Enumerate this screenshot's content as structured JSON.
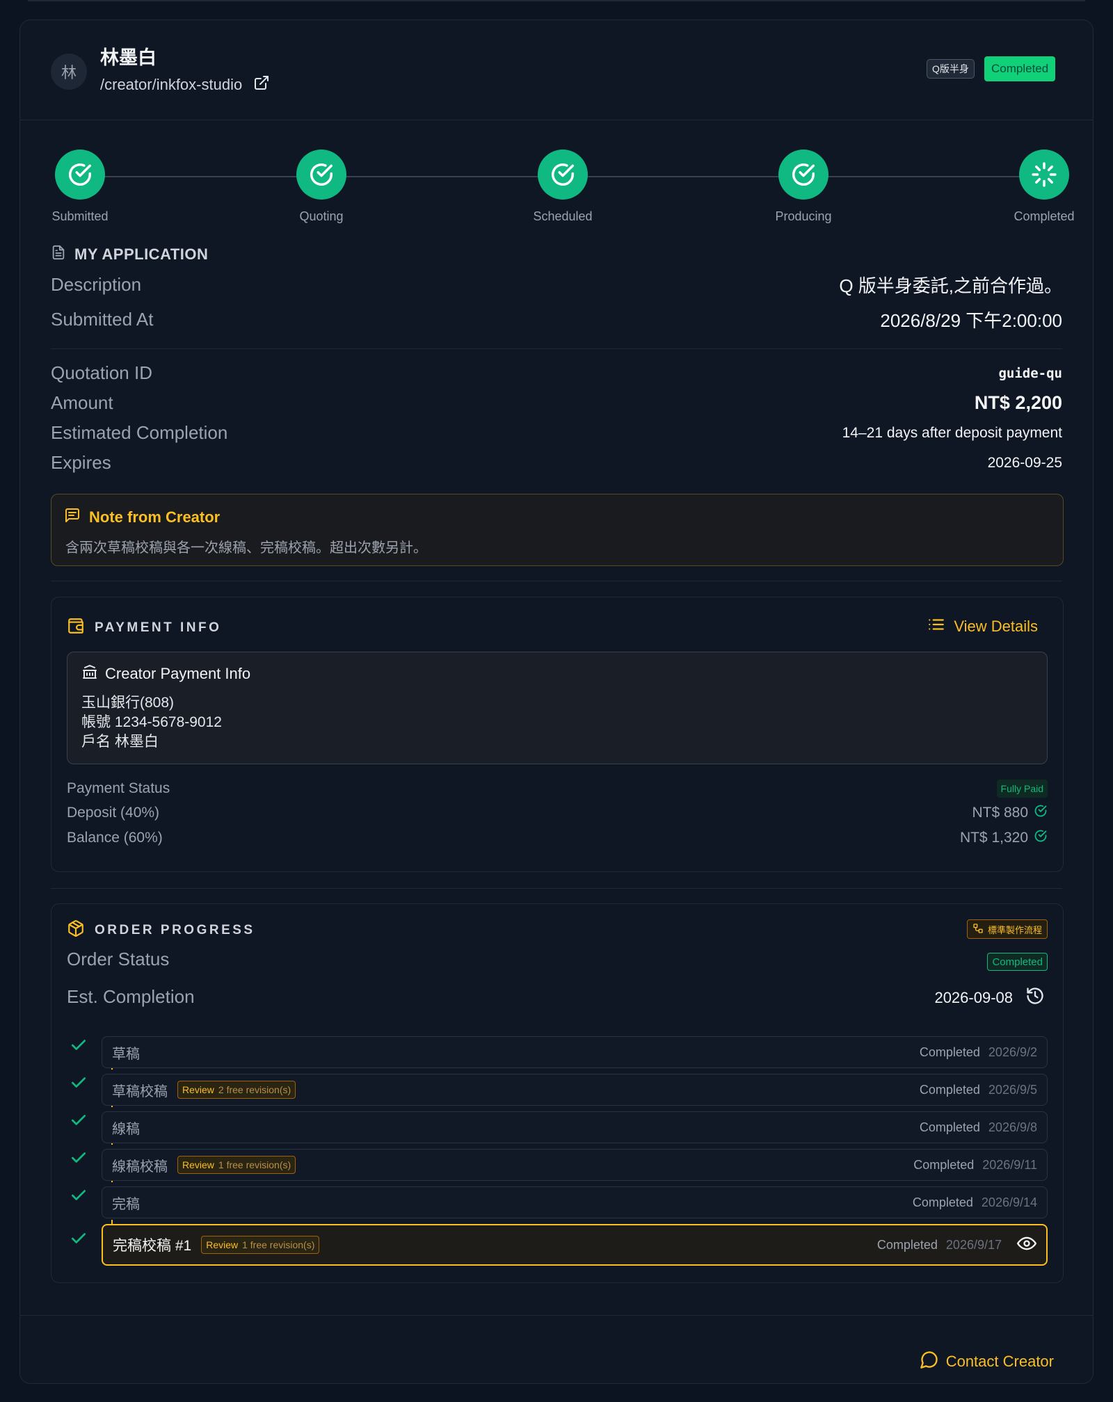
{
  "creator": {
    "avatar_initial": "林",
    "name": "林墨白",
    "path": "/creator/inkfox-studio",
    "type_tag": "Q版半身",
    "status_badge": "Completed"
  },
  "steps": [
    {
      "label": "Submitted",
      "icon": "check-circle-icon"
    },
    {
      "label": "Quoting",
      "icon": "check-circle-icon"
    },
    {
      "label": "Scheduled",
      "icon": "check-circle-icon"
    },
    {
      "label": "Producing",
      "icon": "check-circle-icon"
    },
    {
      "label": "Completed",
      "icon": "spinner-icon"
    }
  ],
  "application": {
    "title": "MY APPLICATION",
    "description_label": "Description",
    "description_value": "Q 版半身委託,之前合作過。",
    "submitted_label": "Submitted At",
    "submitted_value": "2026/8/29 下午2:00:00"
  },
  "quotation": {
    "id_label": "Quotation ID",
    "id_value": "guide-qu",
    "amount_label": "Amount",
    "amount_value": "NT$ 2,200",
    "estimated_label": "Estimated Completion",
    "estimated_value": "14–21 days after deposit payment",
    "expires_label": "Expires",
    "expires_value": "2026-09-25"
  },
  "note": {
    "title": "Note from Creator",
    "text": "含兩次草稿校稿與各一次線稿、完稿校稿。超出次數另計。"
  },
  "payment": {
    "title": "PAYMENT INFO",
    "view_details": "View Details",
    "bank_title": "Creator Payment Info",
    "bank_lines": [
      "玉山銀行(808)",
      "帳號 1234-5678-9012",
      "戶名 林墨白"
    ],
    "status_label": "Payment Status",
    "status_value": "Fully Paid",
    "deposit_label": "Deposit (40%)",
    "deposit_value": "NT$ 880",
    "balance_label": "Balance (60%)",
    "balance_value": "NT$ 1,320"
  },
  "order": {
    "title": "ORDER PROGRESS",
    "flow_tag": "標準製作流程",
    "status_label": "Order Status",
    "status_value": "Completed",
    "est_label": "Est. Completion",
    "est_value": "2026-09-08",
    "milestones": [
      {
        "name": "草稿",
        "review": "",
        "revisions": "",
        "status": "Completed",
        "date": "2026/9/2"
      },
      {
        "name": "草稿校稿",
        "review": "Review",
        "revisions": "2 free revision(s)",
        "status": "Completed",
        "date": "2026/9/5"
      },
      {
        "name": "線稿",
        "review": "",
        "revisions": "",
        "status": "Completed",
        "date": "2026/9/8"
      },
      {
        "name": "線稿校稿",
        "review": "Review",
        "revisions": "1 free revision(s)",
        "status": "Completed",
        "date": "2026/9/11"
      },
      {
        "name": "完稿",
        "review": "",
        "revisions": "",
        "status": "Completed",
        "date": "2026/9/14"
      },
      {
        "name": "完稿校稿 #1",
        "review": "Review",
        "revisions": "1 free revision(s)",
        "status": "Completed",
        "date": "2026/9/17"
      }
    ]
  },
  "footer": {
    "contact": "Contact Creator"
  },
  "colors": {
    "accent_green": "#10b981",
    "accent_yellow": "#fbbf24",
    "background": "#0d1421"
  }
}
